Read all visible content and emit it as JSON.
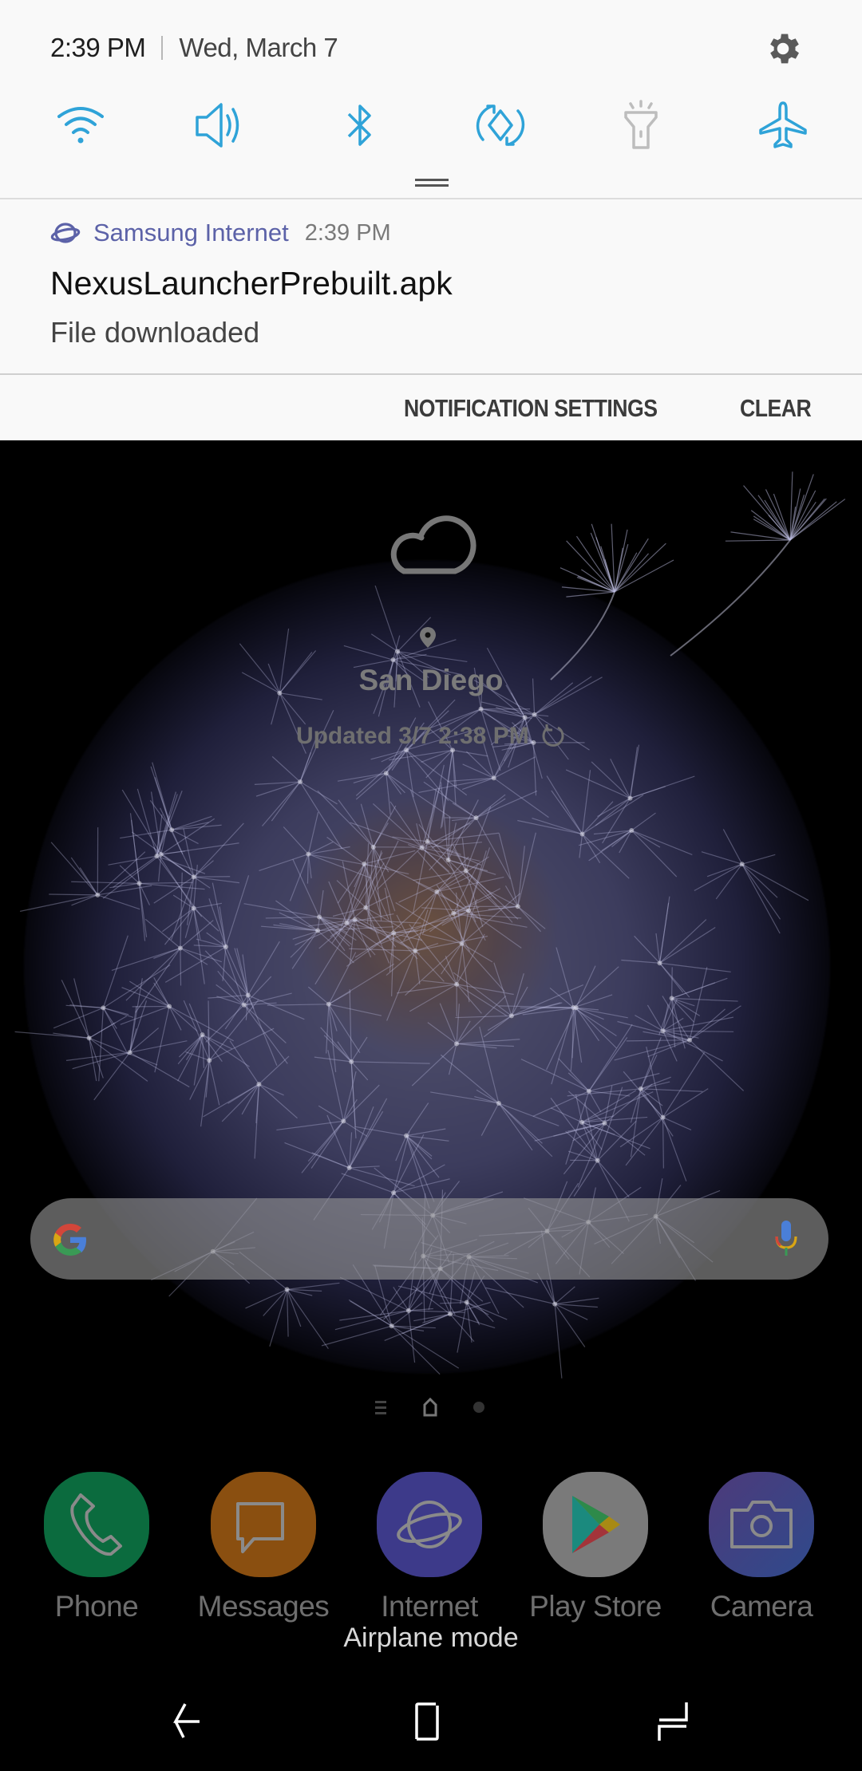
{
  "status": {
    "time": "2:39 PM",
    "date": "Wed, March 7"
  },
  "quick_settings": [
    {
      "name": "wifi",
      "icon": "wifi-icon",
      "state": "on",
      "color": "#2fa3d8"
    },
    {
      "name": "sound",
      "icon": "volume-icon",
      "state": "on",
      "color": "#2fa3d8"
    },
    {
      "name": "bluetooth",
      "icon": "bluetooth-icon",
      "state": "on",
      "color": "#2fa3d8"
    },
    {
      "name": "auto-rotate",
      "icon": "rotate-icon",
      "state": "on",
      "color": "#2fa3d8"
    },
    {
      "name": "flashlight",
      "icon": "flashlight-icon",
      "state": "off",
      "color": "#bdbdbd"
    },
    {
      "name": "airplane-mode",
      "icon": "airplane-icon",
      "state": "on",
      "color": "#2fa3d8"
    }
  ],
  "notification": {
    "app": "Samsung Internet",
    "time": "2:39 PM",
    "title": "NexusLauncherPrebuilt.apk",
    "text": "File downloaded",
    "app_color": "#5c62a8"
  },
  "actions": {
    "settings_label": "NOTIFICATION SETTINGS",
    "clear_label": "CLEAR"
  },
  "weather": {
    "city": "San Diego",
    "updated": "Updated 3/7 2:38 PM"
  },
  "dock": [
    {
      "label": "Phone",
      "color": "#0b6b3e"
    },
    {
      "label": "Messages",
      "color": "#8a4f10"
    },
    {
      "label": "Internet",
      "color": "#3d3a8a"
    },
    {
      "label": "Play Store",
      "color": "#7a7a7a"
    },
    {
      "label": "Camera",
      "color": "#3b3f8c"
    }
  ],
  "toast": "Airplane mode"
}
